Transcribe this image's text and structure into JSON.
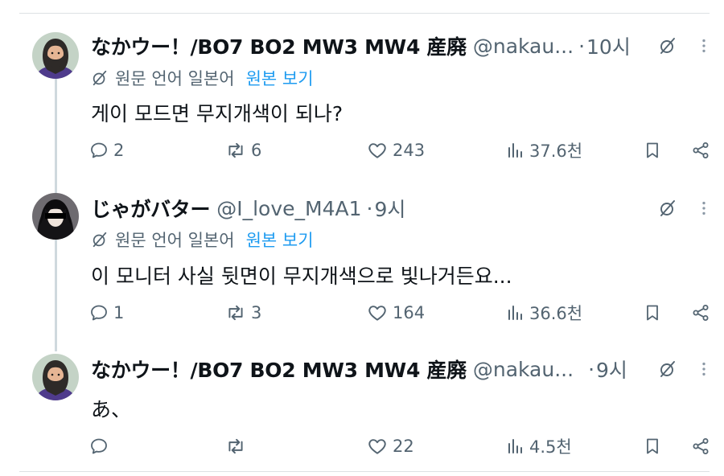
{
  "tweets": [
    {
      "name": "なかウー！/BO7 BO2 MW3 MW4 産廃",
      "handle": "@nakau...",
      "sep": "·",
      "time": "10시",
      "translate_label": "원문 언어 일본어",
      "translate_link": "원본 보기",
      "text": "게이 모드면 무지개색이 되나?",
      "replies": "2",
      "reposts": "6",
      "likes": "243",
      "views": "37.6천"
    },
    {
      "name": "じゃがバター",
      "handle": "@I_love_M4A1",
      "sep": "·",
      "time": "9시",
      "translate_label": "원문 언어 일본어",
      "translate_link": "원본 보기",
      "text": "이 모니터 사실 뒷면이 무지개색으로 빛나거든요...",
      "replies": "1",
      "reposts": "3",
      "likes": "164",
      "views": "36.6천"
    },
    {
      "name": "なかウー！/BO7 BO2 MW3 MW4 産廃",
      "handle": "@nakau...",
      "sep": "·",
      "time": "9시",
      "text": "あ、",
      "replies": "",
      "reposts": "",
      "likes": "22",
      "views": "4.5천"
    }
  ],
  "colors": {
    "text": "#0f1419",
    "muted": "#536471",
    "link": "#1d9bf0",
    "divider": "#dde1e4"
  },
  "icons": [
    "reply-icon",
    "repost-icon",
    "like-icon",
    "views-icon",
    "bookmark-icon",
    "share-icon",
    "grok-icon",
    "more-icon",
    "translate-icon"
  ]
}
